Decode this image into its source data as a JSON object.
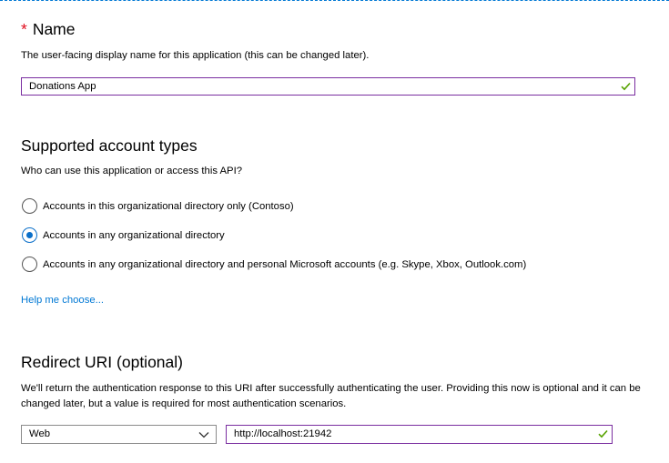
{
  "name_section": {
    "required_marker": "*",
    "title": "Name",
    "description": "The user-facing display name for this application (this can be changed later).",
    "input_value": "Donations App",
    "valid_icon": "check-icon"
  },
  "account_types": {
    "title": "Supported account types",
    "question": "Who can use this application or access this API?",
    "options": [
      {
        "label": "Accounts in this organizational directory only (Contoso)",
        "selected": false
      },
      {
        "label": "Accounts in any organizational directory",
        "selected": true
      },
      {
        "label": "Accounts in any organizational directory and personal Microsoft accounts (e.g. Skype, Xbox, Outlook.com)",
        "selected": false
      }
    ],
    "help_link": "Help me choose..."
  },
  "redirect_uri": {
    "title": "Redirect URI (optional)",
    "description": "We'll return the authentication response to this URI after successfully authenticating the user. Providing this now is optional and it can be changed later, but a value is required for most authentication scenarios.",
    "platform_selected": "Web",
    "uri_value": "http://localhost:21942",
    "valid_icon": "check-icon"
  },
  "colors": {
    "accent": "#0078d4",
    "required": "#e00b1c",
    "input_border": "#7a2ea0",
    "valid": "#57a300"
  }
}
